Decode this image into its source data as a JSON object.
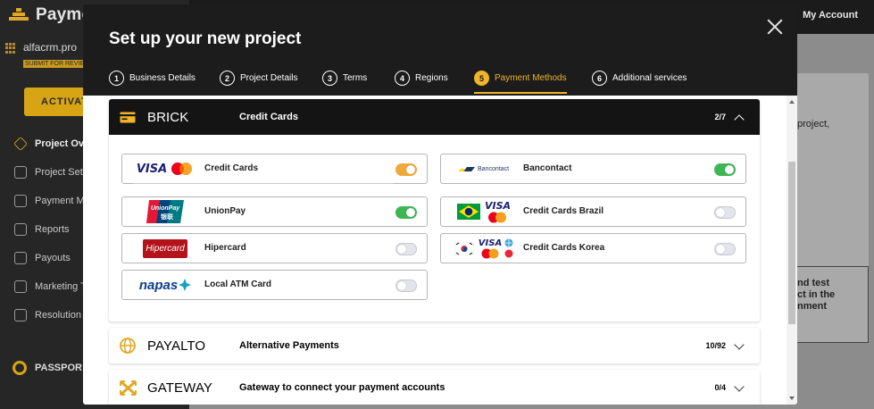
{
  "background": {
    "brand": "Payme",
    "project_name": "alfacrm.pro",
    "project_tag": "SUBMIT FOR REVIEW",
    "activate_label": "ACTIVAT",
    "nav": [
      "Project Ove",
      "Project Set",
      "Payment M",
      "Reports",
      "Payouts",
      "Marketing T",
      "Resolution"
    ],
    "passport_label": "PASSPOR",
    "account_label": "My Account",
    "main_text_1": "project,",
    "main_box_lines": [
      "nd test",
      "ct in the",
      "nment"
    ]
  },
  "modal": {
    "title": "Set up your new project",
    "steps": [
      {
        "num": "1",
        "label": "Business Details"
      },
      {
        "num": "2",
        "label": "Project Details"
      },
      {
        "num": "3",
        "label": "Terms"
      },
      {
        "num": "4",
        "label": "Regions"
      },
      {
        "num": "5",
        "label": "Payment Methods"
      },
      {
        "num": "6",
        "label": "Additional services"
      }
    ],
    "active_step": 5,
    "sections": {
      "brick": {
        "name": "BRICK",
        "desc": "Credit Cards",
        "count": "2/7",
        "methods": [
          {
            "label": "Credit Cards",
            "enabled": true,
            "toggle_color": "#f0a83a",
            "icon": "visa-mastercard-logo"
          },
          {
            "label": "Bancontact",
            "enabled": true,
            "toggle_color": "#3fb655",
            "icon": "bancontact-logo"
          },
          {
            "label": "UnionPay",
            "enabled": true,
            "toggle_color": "#3fb655",
            "icon": "unionpay-logo"
          },
          {
            "label": "Credit Cards Brazil",
            "enabled": false,
            "icon": "brazil-visa-mastercard-logo"
          },
          {
            "label": "Hipercard",
            "enabled": false,
            "icon": "hipercard-logo"
          },
          {
            "label": "Credit Cards Korea",
            "enabled": false,
            "icon": "korea-cards-logo"
          },
          {
            "label": "Local ATM Card",
            "enabled": false,
            "icon": "napas-logo"
          }
        ],
        "logo_text": {
          "visa": "VISA",
          "bancontact": "Bancontact",
          "unionpay": "UnionPay",
          "unionpay_cn": "银联",
          "hipercard": "Hipercard",
          "napas": "napas"
        }
      },
      "payalto": {
        "name": "PAYALTO",
        "desc": "Alternative Payments",
        "count": "10/92"
      },
      "gateway": {
        "name": "GATEWAY",
        "desc": "Gateway to connect your payment accounts",
        "count": "0/4"
      }
    }
  },
  "colors": {
    "accent": "#f0b429",
    "header_dark": "#141414",
    "toggle_on_orange": "#f0a83a",
    "toggle_on_green": "#3fb655"
  }
}
